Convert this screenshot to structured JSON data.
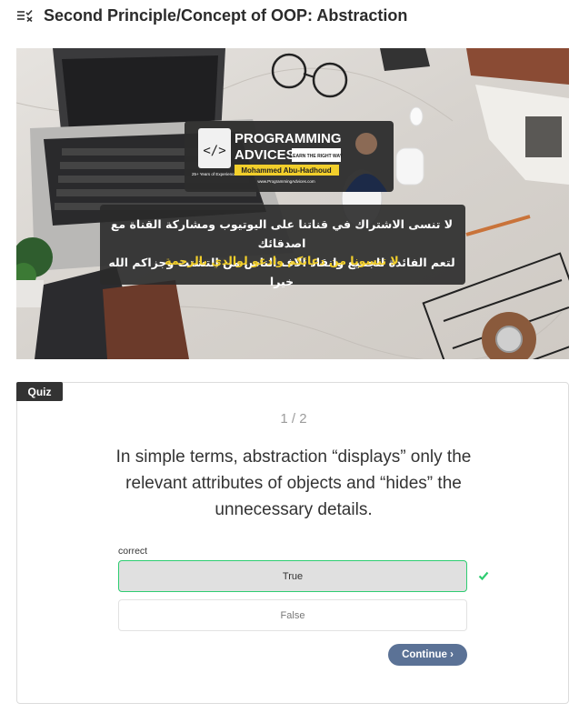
{
  "lesson": {
    "title": "Second Principle/Concept of OOP: Abstraction",
    "icon": "checklist-icon"
  },
  "banner": {
    "brand_line1": "PROGRAMMING",
    "brand_line2": "ADVICES",
    "tagline": "LEARN THE RIGHT WAY",
    "presenter": "Mohammed Abu-Hadhoud",
    "experience": "25+ Years of Experience",
    "website": "www.ProgrammingAdvices.com",
    "arabic_line1": "لا تنسى الاشتراك في قناتنا على اليوتيوب ومشاركة القناة مع اصدقائك",
    "arabic_line2": "لتعم الفائدة للجميع وانقاذ الاف الناس من التشتت وجزاكم الله خيرا",
    "arabic_line3": "لا تنسونا من دعائكم وادعو لوالدي بالرحمة"
  },
  "quiz": {
    "tab_label": "Quiz",
    "counter": "1 / 2",
    "question": "In simple terms, abstraction “displays” only the relevant attributes of objects and “hides” the unnecessary details.",
    "feedback": "correct",
    "options": [
      {
        "label": "True",
        "selected": true,
        "correct": true
      },
      {
        "label": "False",
        "selected": false,
        "correct": false
      }
    ],
    "continue_label": "Continue ›",
    "accent_color": "#5b7296",
    "correct_color": "#2ecc71"
  }
}
